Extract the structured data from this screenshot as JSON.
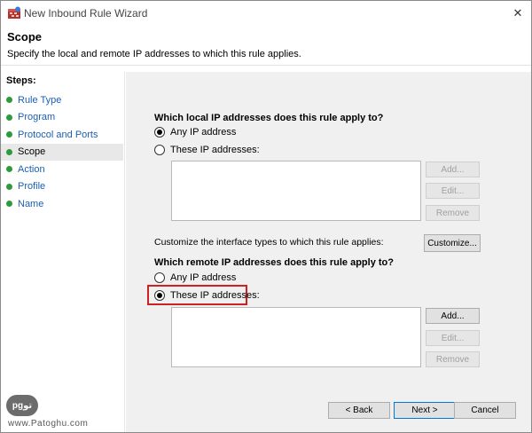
{
  "window": {
    "title": "New Inbound Rule Wizard",
    "close_glyph": "✕"
  },
  "header": {
    "title": "Scope",
    "description": "Specify the local and remote IP addresses to which this rule applies."
  },
  "sidebar": {
    "steps_label": "Steps:",
    "items": [
      {
        "label": "Rule Type",
        "active": false
      },
      {
        "label": "Program",
        "active": false
      },
      {
        "label": "Protocol and Ports",
        "active": false
      },
      {
        "label": "Scope",
        "active": true
      },
      {
        "label": "Action",
        "active": false
      },
      {
        "label": "Profile",
        "active": false
      },
      {
        "label": "Name",
        "active": false
      }
    ],
    "step_dot_color": "#2e9b3a"
  },
  "local": {
    "question": "Which local IP addresses does this rule apply to?",
    "option_any": "Any IP address",
    "option_these": "These IP addresses:",
    "selected": "any",
    "add_label": "Add...",
    "edit_label": "Edit...",
    "remove_label": "Remove"
  },
  "customize": {
    "text": "Customize the interface types to which this rule applies:",
    "button_label": "Customize..."
  },
  "remote": {
    "question": "Which remote IP addresses does this rule apply to?",
    "option_any": "Any IP address",
    "option_these": "These IP addresses:",
    "selected": "these",
    "add_label": "Add...",
    "edit_label": "Edit...",
    "remove_label": "Remove"
  },
  "footer": {
    "back_label": "< Back",
    "next_label": "Next >",
    "cancel_label": "Cancel"
  },
  "watermark": {
    "badge": "pgتو",
    "text": "www.Patoghu.com"
  },
  "colors": {
    "highlight": "#cc2222",
    "link": "#1a5fb4",
    "primary_border": "#0078d7"
  }
}
